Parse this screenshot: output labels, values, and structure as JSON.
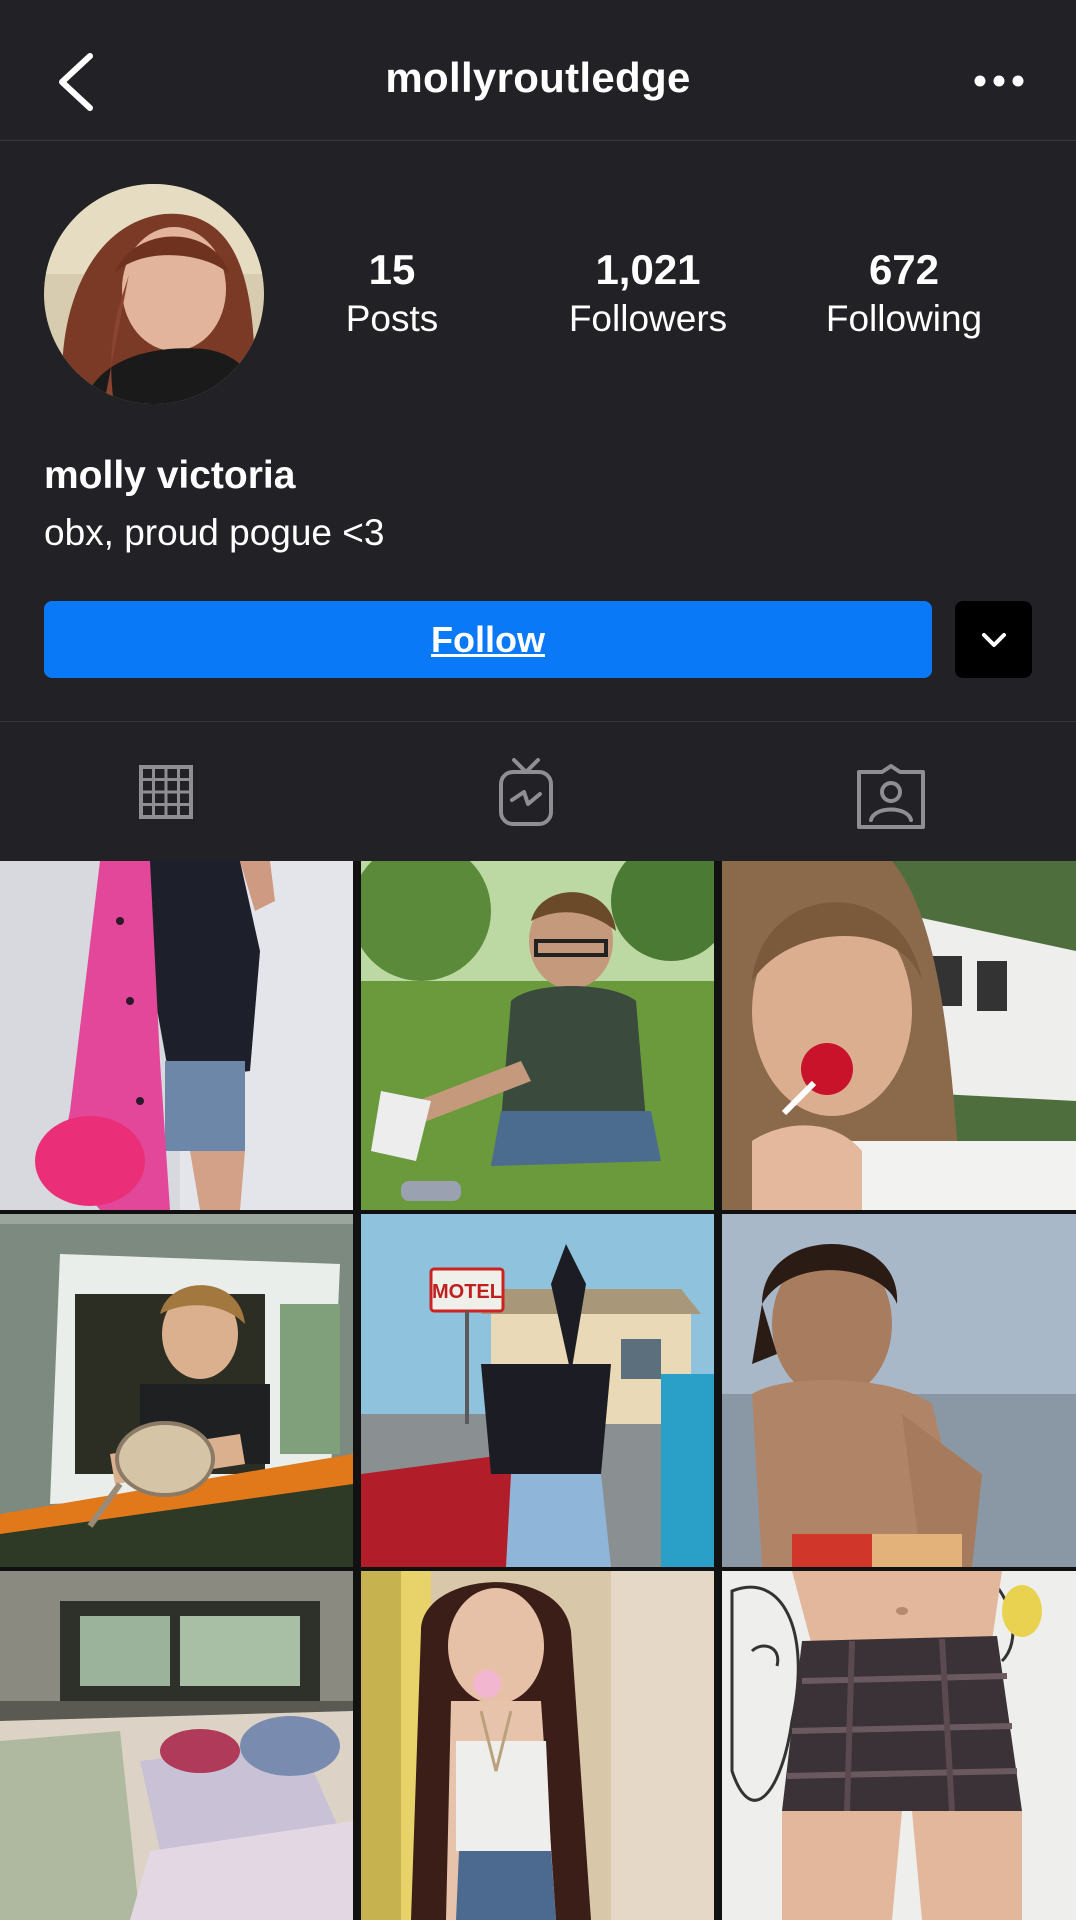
{
  "header": {
    "username": "mollyroutledge",
    "back_icon": "chevron-left-icon",
    "more_icon": "ellipsis-icon"
  },
  "profile": {
    "display_name": "molly victoria",
    "bio": "obx, proud pogue <3",
    "stats": {
      "posts": {
        "value": "15",
        "label": "Posts"
      },
      "followers": {
        "value": "1,021",
        "label": "Followers"
      },
      "following": {
        "value": "672",
        "label": "Following"
      }
    }
  },
  "actions": {
    "follow_label": "Follow",
    "dropdown_icon": "chevron-down-icon"
  },
  "tabs": [
    {
      "name": "posts-grid",
      "icon": "grid-icon",
      "active": true
    },
    {
      "name": "igtv",
      "icon": "igtv-icon",
      "active": false
    },
    {
      "name": "tagged",
      "icon": "tagged-person-icon",
      "active": false
    }
  ],
  "grid": {
    "posts": [
      {
        "description_icon": "photo-thumbnail",
        "caption_visible": ""
      },
      {
        "description_icon": "photo-thumbnail",
        "caption_visible": ""
      },
      {
        "description_icon": "photo-thumbnail",
        "caption_visible": ""
      },
      {
        "description_icon": "photo-thumbnail",
        "caption_visible": ""
      },
      {
        "description_icon": "photo-thumbnail",
        "caption_visible": "MOTEL"
      },
      {
        "description_icon": "photo-thumbnail",
        "caption_visible": ""
      },
      {
        "description_icon": "photo-thumbnail",
        "caption_visible": ""
      },
      {
        "description_icon": "photo-thumbnail",
        "caption_visible": ""
      },
      {
        "description_icon": "photo-thumbnail",
        "caption_visible": ""
      }
    ]
  },
  "colors": {
    "background": "#222226",
    "follow_button": "#0a79f7",
    "divider": "#38383c",
    "icon": "#8e8e93"
  }
}
